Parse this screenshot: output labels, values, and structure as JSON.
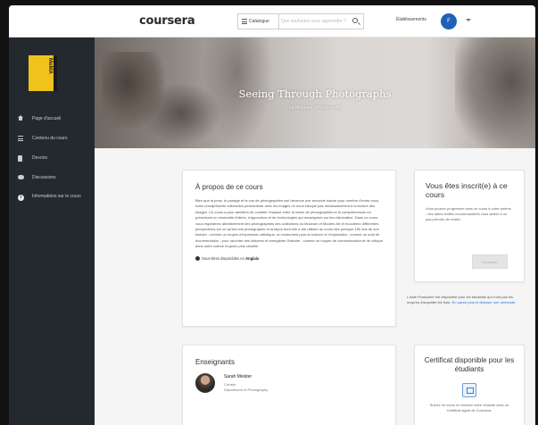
{
  "topbar": {
    "logo": "coursera",
    "catalog_label": "Catalogue",
    "search_placeholder": "Que souhaitez-vous apprendre ?",
    "organizations_label": "Établissements",
    "avatar_initial": "F"
  },
  "sidebar": {
    "course_logo_text": "MoMA",
    "items": [
      {
        "label": "Page d'accueil",
        "icon": "home-icon"
      },
      {
        "label": "Contenu du cours",
        "icon": "list-icon"
      },
      {
        "label": "Devoirs",
        "icon": "grades-icon"
      },
      {
        "label": "Discussions",
        "icon": "chat-icon"
      },
      {
        "label": "Informations sur le cours",
        "icon": "info-icon"
      }
    ]
  },
  "banner": {
    "title": "Seeing Through Photographs",
    "subtitle": "Le Museum of Modern Art"
  },
  "about": {
    "heading": "À propos de ce cours",
    "body": "Bien que la prise, le partage et la vue de photographies soit devenue une seconde nature pour nombre d'entre nous, notre omniprésente interaction permanente avec les images ne nous éduque pas nécessairement à la lecture des images. Ce cours a pour ambition de combler l'espace entre la vision de photographies et la compréhension en présentant un ensemble d'idées, d'approches et de technologies qui renseignent sur leur fabrication. Dans ce cours vous regarderez attentivement des photographies des collections du Museum of Modern Art et écouterez différentes perspectives sur ce qu'est une photographie et la façon dont elle a été utilisée au cours des presque 180 ans de son histoire : comme un moyen d'expression artistique, un instrument pour la science et l'exploration ; comme un outil de documentation ; pour raconter des histoires et enregistrer l'histoire ; comme un moyen de communication et de critique dans notre culture toujours plus visuelle.",
    "subtitles_prefix": "Sous-titres disponibles en",
    "subtitles_language": "Anglais"
  },
  "teachers": {
    "heading": "Enseignants",
    "list": [
      {
        "name": "Sarah Meister",
        "role": "Curator",
        "department": "Department of Photography"
      }
    ]
  },
  "enroll": {
    "heading": "Vous êtes inscrit(e) à ce cours",
    "body": "Vous pouvez progresser dans ce cours à votre rythme ; des dates limites recommandées vous aident à ne pas prendre de retard.",
    "button_label": "Continuer"
  },
  "aid": {
    "text": "L'Aide Financière est disponible pour les étudiants qui n'ont pas les moyens d'acquitter les frais.",
    "link": "En savoir plus et déposer une demande."
  },
  "certificate": {
    "heading": "Certificat disponible pour les étudiants",
    "body": "Suivez ce cours et montrez votre réussite avec un Certificat signé de Coursera."
  },
  "colors": {
    "sidebar_bg": "#24292f",
    "accent_blue": "#1f61b8",
    "logo_yellow": "#f1c21b"
  }
}
